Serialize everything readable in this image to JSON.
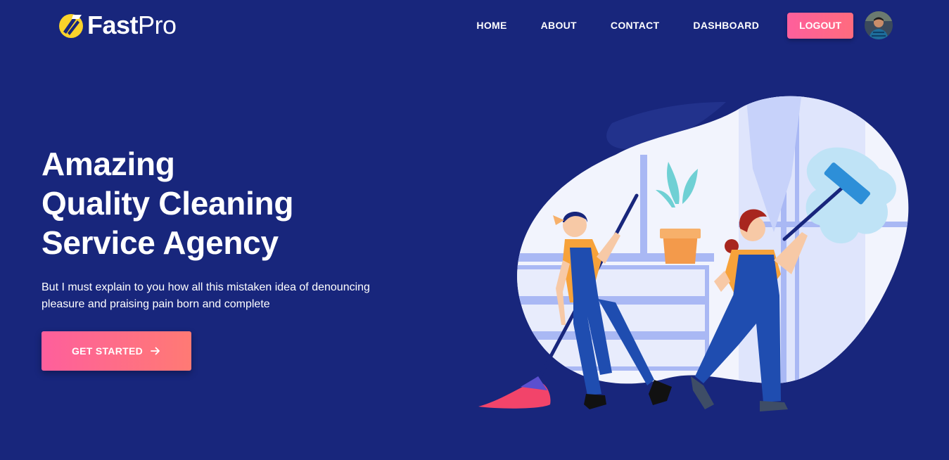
{
  "brand": {
    "name_bold": "Fast",
    "name_light": "Pro"
  },
  "nav": {
    "items": [
      {
        "label": "HOME"
      },
      {
        "label": "ABOUT"
      },
      {
        "label": "CONTACT"
      },
      {
        "label": "DASHBOARD"
      }
    ],
    "logout_label": "LOGOUT"
  },
  "hero": {
    "title_lines": [
      "Amazing",
      "Quality Cleaning",
      "Service Agency"
    ],
    "description": "But I must explain to you how all this mistaken idea of denouncing pleasure and praising pain born and complete",
    "cta_label": "GET STARTED"
  },
  "colors": {
    "background": "#18267c",
    "accent_pink": "#fe5f9c",
    "accent_coral": "#ff7a74",
    "logo_yellow": "#fbd32a"
  },
  "icons": {
    "logo": "fastpro-logo-icon",
    "cta_arrow": "arrow-right-icon",
    "avatar": "user-avatar"
  }
}
